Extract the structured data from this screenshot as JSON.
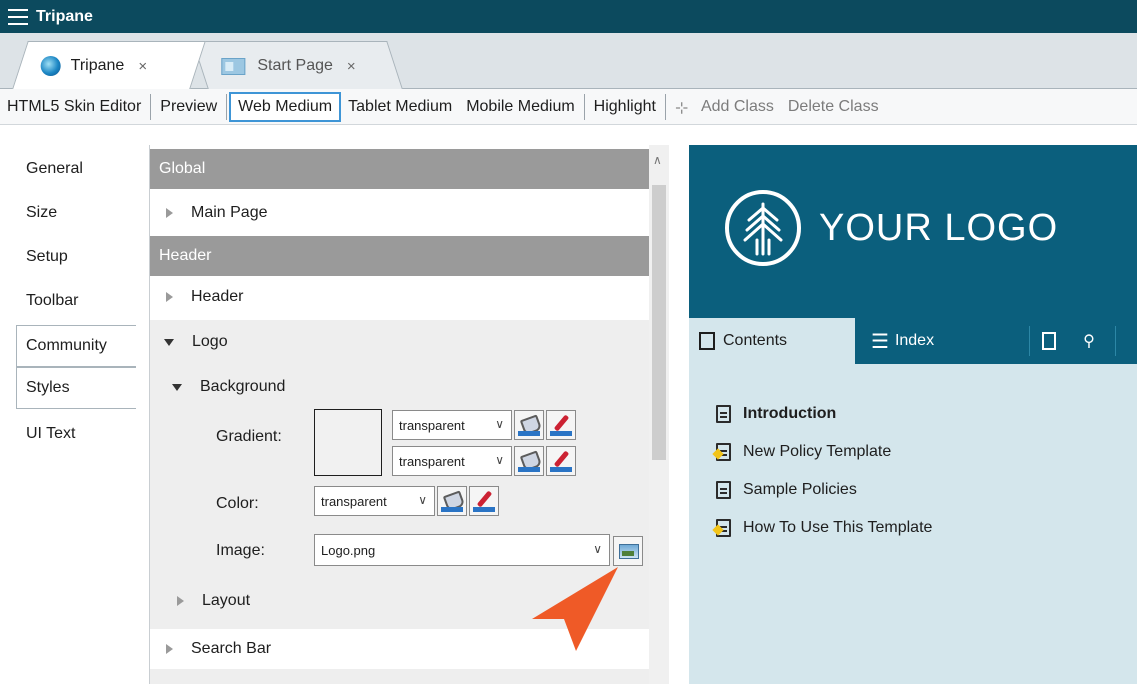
{
  "app": {
    "title": "Tripane"
  },
  "tabs": [
    {
      "label": "Tripane",
      "close": "×"
    },
    {
      "label": "Start Page",
      "close": "×"
    }
  ],
  "toolbar": {
    "html5_skin_editor": "HTML5 Skin Editor",
    "preview": "Preview",
    "web_medium": "Web Medium",
    "tablet_medium": "Tablet Medium",
    "mobile_medium": "Mobile Medium",
    "highlight": "Highlight",
    "add_class": "Add Class",
    "delete_class": "Delete Class"
  },
  "leftnav": {
    "items": [
      {
        "label": "General"
      },
      {
        "label": "Size"
      },
      {
        "label": "Setup"
      },
      {
        "label": "Toolbar"
      },
      {
        "label": "Community"
      },
      {
        "label": "Styles"
      },
      {
        "label": "UI Text"
      }
    ]
  },
  "editor": {
    "global_header": "Global",
    "main_page": "Main Page",
    "header_group": "Header",
    "header_item": "Header",
    "logo": "Logo",
    "background": "Background",
    "gradient_label": "Gradient:",
    "gradient_stop1": "transparent",
    "gradient_stop2": "transparent",
    "color_label": "Color:",
    "color_value": "transparent",
    "image_label": "Image:",
    "image_value": "Logo.png",
    "layout": "Layout",
    "search_bar": "Search Bar"
  },
  "preview": {
    "logo_text": "YOUR LOGO",
    "tab_contents": "Contents",
    "tab_index": "Index",
    "toc": [
      {
        "label": "Introduction"
      },
      {
        "label": "New Policy Template"
      },
      {
        "label": "Sample Policies"
      },
      {
        "label": "How To Use This Template"
      }
    ]
  },
  "colors": {
    "titlebar": "#0c4a5e",
    "preview_header": "#0b5f7d",
    "preview_body": "#d4e6ec",
    "group_header": "#9a9a9a",
    "arrow": "#ef5a27",
    "selection_border": "#3e95d6"
  },
  "icons": [
    "menu-icon",
    "tripane-app-icon",
    "start-page-icon",
    "add-class-icon",
    "expand-arrow-icon",
    "collapse-arrow-icon",
    "paint-bucket-icon",
    "eyedropper-icon",
    "image-browse-icon",
    "tree-logo-icon",
    "contents-icon",
    "index-list-icon",
    "glossary-icon",
    "search-person-icon",
    "document-icon",
    "new-star-icon",
    "pointer-arrow-icon"
  ]
}
